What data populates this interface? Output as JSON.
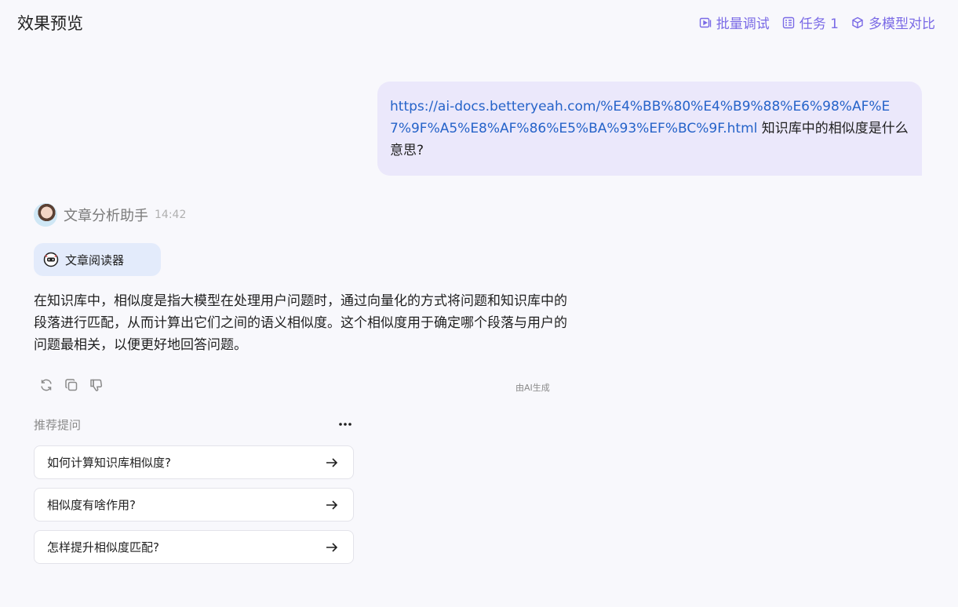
{
  "header": {
    "title": "效果预览",
    "actions": [
      {
        "label": "批量调试",
        "icon": "play-square-icon"
      },
      {
        "label": "任务 1",
        "icon": "task-list-icon"
      },
      {
        "label": "多模型对比",
        "icon": "cube-icon"
      }
    ]
  },
  "user_message": {
    "link": "https://ai-docs.betteryeah.com/%E4%BB%80%E4%B9%88%E6%98%AF%E7%9F%A5%E8%AF%86%E5%BA%93%EF%BC%9F.html",
    "text": " 知识库中的相似度是什么意思?"
  },
  "assistant": {
    "name": "文章分析助手",
    "time": "14:42",
    "tool": "文章阅读器",
    "answer": "在知识库中，相似度是指大模型在处理用户问题时，通过向量化的方式将问题和知识库中的段落进行匹配，从而计算出它们之间的语义相似度。这个相似度用于确定哪个段落与用户的问题最相关，以便更好地回答问题。",
    "ai_label": "由AI生成"
  },
  "recommend": {
    "title": "推荐提问",
    "items": [
      "如何计算知识库相似度?",
      "相似度有啥作用?",
      "怎样提升相似度匹配?"
    ]
  },
  "colors": {
    "accent": "#7a6ae6",
    "link": "#2563c9",
    "user_bubble": "#ebe8fb",
    "tool_chip": "#e3ebfb"
  }
}
